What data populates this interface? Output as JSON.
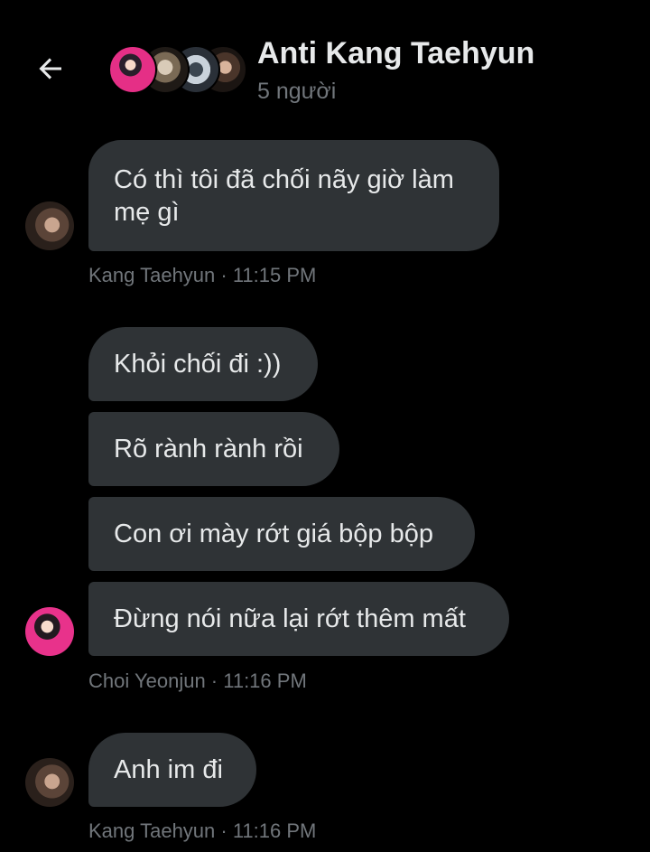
{
  "header": {
    "back_icon": "arrow-left-icon",
    "title": "Anti Kang Taehyun",
    "subtitle": "5 người"
  },
  "colors": {
    "background": "#000000",
    "bubble": "#2f3336",
    "text": "#e7e9ea",
    "muted": "#71767b"
  },
  "messages": [
    {
      "text": "Có thì tôi đã chối nãy giờ làm mẹ gì"
    },
    {
      "meta": "Kang Taehyun · 11:15 PM"
    },
    {
      "text": "Khỏi chối đi :))"
    },
    {
      "text": "Rõ rành rành rồi"
    },
    {
      "text": "Con ơi mày rớt giá bộp bộp"
    },
    {
      "text": "Đừng nói nữa lại rớt thêm mất"
    },
    {
      "meta": "Choi Yeonjun · 11:16 PM"
    },
    {
      "text": "Anh im đi"
    },
    {
      "meta": "Kang Taehyun · 11:16 PM"
    }
  ]
}
